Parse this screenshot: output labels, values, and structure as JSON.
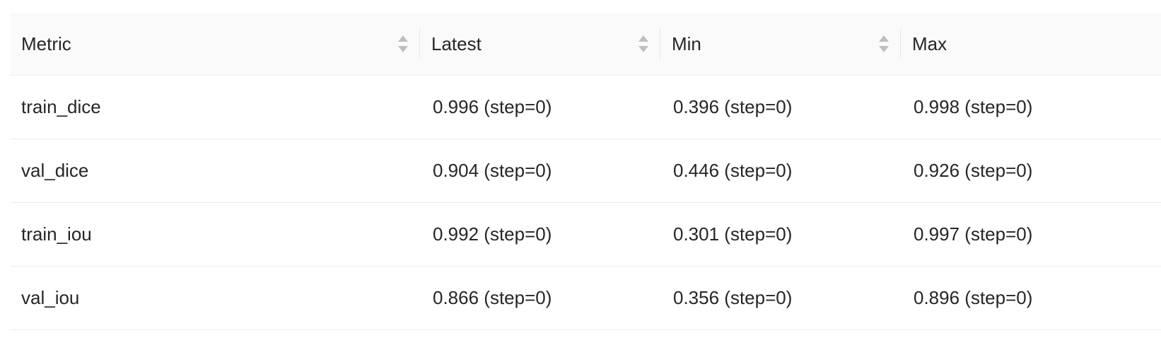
{
  "table": {
    "columns": [
      {
        "label": "Metric",
        "sortable": true
      },
      {
        "label": "Latest",
        "sortable": true
      },
      {
        "label": "Min",
        "sortable": true
      },
      {
        "label": "Max",
        "sortable": false
      }
    ],
    "rows": [
      {
        "metric": "train_dice",
        "latest": "0.996 (step=0)",
        "min": "0.396 (step=0)",
        "max": "0.998 (step=0)"
      },
      {
        "metric": "val_dice",
        "latest": "0.904 (step=0)",
        "min": "0.446 (step=0)",
        "max": "0.926 (step=0)"
      },
      {
        "metric": "train_iou",
        "latest": "0.992 (step=0)",
        "min": "0.301 (step=0)",
        "max": "0.997 (step=0)"
      },
      {
        "metric": "val_iou",
        "latest": "0.866 (step=0)",
        "min": "0.356 (step=0)",
        "max": "0.896 (step=0)"
      }
    ]
  },
  "colors": {
    "header_bg": "#fafafa",
    "border": "#ececec",
    "text": "#262626",
    "sort_icon": "#bfbfbf"
  }
}
